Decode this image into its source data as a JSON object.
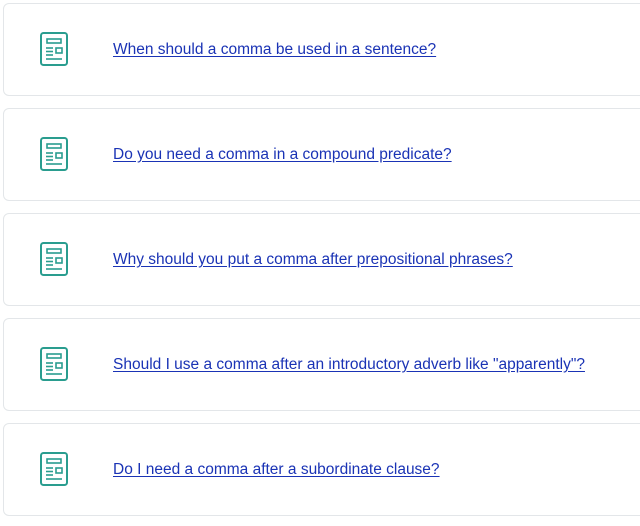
{
  "related_questions": [
    {
      "label": "When should a comma be used in a sentence?",
      "icon": "article-icon"
    },
    {
      "label": "Do you need a comma in a compound predicate?",
      "icon": "article-icon"
    },
    {
      "label": "Why should you put a comma after prepositional phrases?",
      "icon": "article-icon"
    },
    {
      "label": "Should I use a comma after an introductory adverb like \"apparently\"?",
      "icon": "article-icon"
    },
    {
      "label": "Do I need a comma after a subordinate clause?",
      "icon": "article-icon"
    }
  ],
  "colors": {
    "link": "#1a33b5",
    "icon": "#2a9d8f",
    "card_border": "#e3e6e9"
  }
}
